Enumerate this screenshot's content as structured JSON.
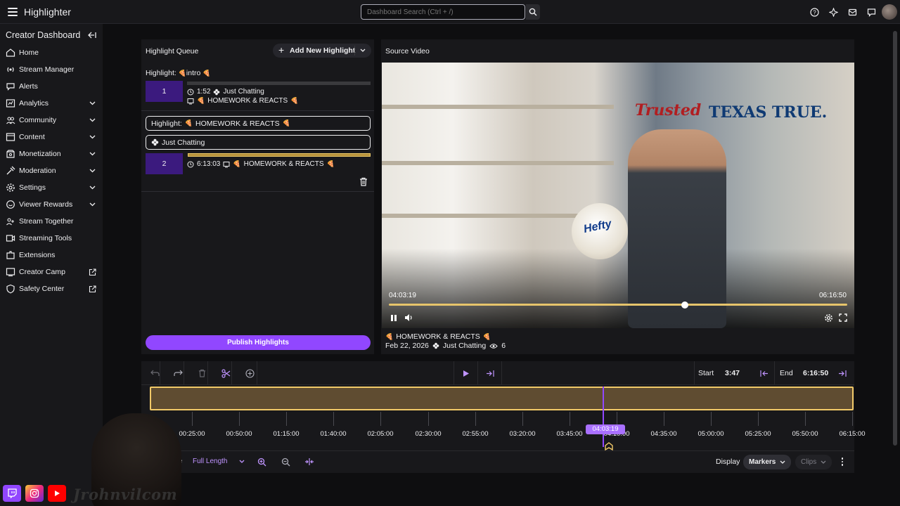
{
  "app": {
    "title": "Highlighter"
  },
  "search": {
    "placeholder": "Dashboard Search (Ctrl + /)"
  },
  "sidebar": {
    "title": "Creator Dashboard",
    "items": [
      {
        "label": "Home",
        "icon": "home-icon",
        "has_chevron": false,
        "external": false
      },
      {
        "label": "Stream Manager",
        "icon": "stream-manager-icon",
        "has_chevron": false,
        "external": false
      },
      {
        "label": "Alerts",
        "icon": "alerts-icon",
        "has_chevron": false,
        "external": false
      },
      {
        "label": "Analytics",
        "icon": "analytics-icon",
        "has_chevron": true,
        "external": false
      },
      {
        "label": "Community",
        "icon": "community-icon",
        "has_chevron": true,
        "external": false
      },
      {
        "label": "Content",
        "icon": "content-icon",
        "has_chevron": true,
        "external": false
      },
      {
        "label": "Monetization",
        "icon": "monetization-icon",
        "has_chevron": true,
        "external": false
      },
      {
        "label": "Moderation",
        "icon": "moderation-icon",
        "has_chevron": true,
        "external": false
      },
      {
        "label": "Settings",
        "icon": "settings-icon",
        "has_chevron": true,
        "external": false
      },
      {
        "label": "Viewer Rewards",
        "icon": "viewer-rewards-icon",
        "has_chevron": true,
        "external": false
      },
      {
        "label": "Stream Together",
        "icon": "stream-together-icon",
        "has_chevron": false,
        "external": false
      },
      {
        "label": "Streaming Tools",
        "icon": "streaming-tools-icon",
        "has_chevron": false,
        "external": false
      },
      {
        "label": "Extensions",
        "icon": "extensions-icon",
        "has_chevron": false,
        "external": false
      },
      {
        "label": "Creator Camp",
        "icon": "creator-camp-icon",
        "has_chevron": false,
        "external": true
      },
      {
        "label": "Safety Center",
        "icon": "safety-center-icon",
        "has_chevron": false,
        "external": true
      }
    ]
  },
  "queue": {
    "title": "Highlight Queue",
    "add_label": "Add New Highlight",
    "highlights": [
      {
        "prefix": "Highlight:",
        "title": "intro",
        "index": "1",
        "duration": "1:52",
        "category": "Just Chatting",
        "stream_title": "HOMEWORK & REACTS"
      },
      {
        "prefix": "Highlight:",
        "title": "HOMEWORK & REACTS",
        "category_box": "Just Chatting",
        "index": "2",
        "duration": "6:13:03",
        "stream_title": "HOMEWORK & REACTS"
      }
    ],
    "publish_label": "Publish Highlights"
  },
  "source": {
    "title": "Source Video",
    "current_time": "04:03:19",
    "end_time": "06:16:50",
    "progress": 0.645,
    "video_title": "HOMEWORK & REACTS",
    "date": "Feb 22, 2026",
    "category": "Just Chatting",
    "views": "6",
    "scene_text_1": "Trusted",
    "scene_text_2": "TEXAS TRUE.",
    "scene_text_3": "Hefty"
  },
  "timeline": {
    "start_label": "Start",
    "start_value": "3:47",
    "end_label": "End",
    "end_value": "6:16:50",
    "ticks": [
      "00:25:00",
      "00:50:00",
      "01:15:00",
      "01:40:00",
      "02:05:00",
      "02:30:00",
      "02:55:00",
      "03:20:00",
      "03:45:00",
      "04:10:00",
      "04:35:00",
      "05:00:00",
      "05:25:00",
      "05:50:00",
      "06:15:00"
    ],
    "playhead_time": "04:03:19",
    "range_label": "ge",
    "range_value": "Full Length",
    "display_label": "Display",
    "markers_label": "Markers",
    "clips_label": "Clips"
  },
  "overlay": {
    "handle": "Jrohnvilcom"
  },
  "colors": {
    "accent": "#9147ff",
    "track": "#5f4c31",
    "track_border": "#f1c968",
    "thumb": "#3b1a7e"
  }
}
